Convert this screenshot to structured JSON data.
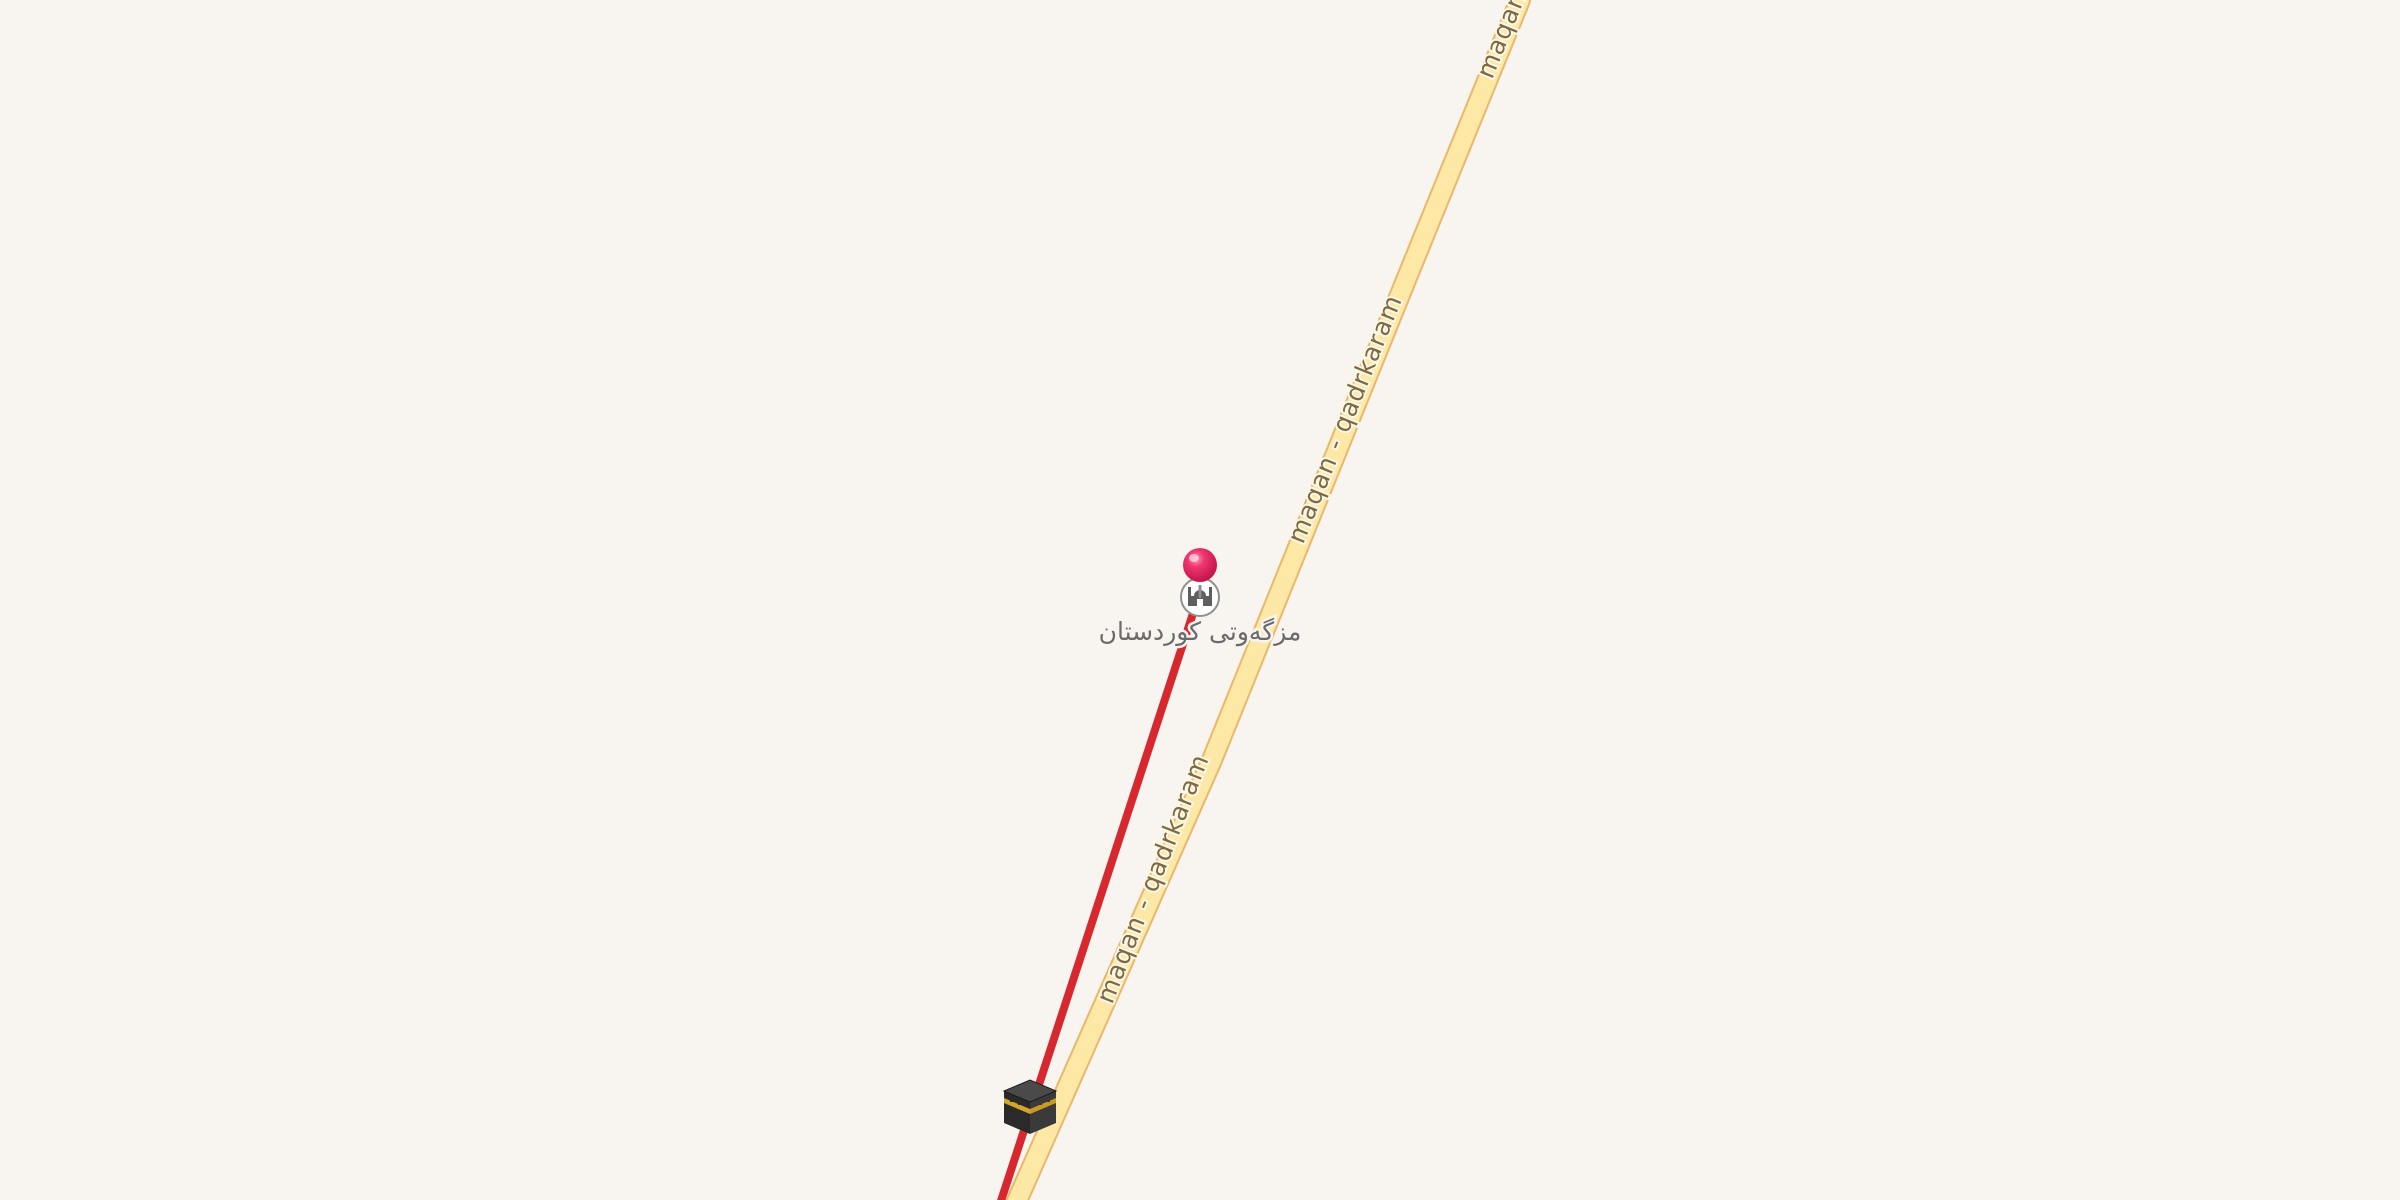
{
  "map": {
    "background_color": "#f8f4f0",
    "road": {
      "name": "maqan - qadrkaram",
      "fill_color": "#fde8a6",
      "casing_color": "#e9b86a"
    },
    "route": {
      "color": "#d7282f"
    },
    "poi": {
      "label": "مزگەوتی کوردستان",
      "icon": "mosque-icon"
    },
    "selected_pin": {
      "color": "#e91e63",
      "icon": "location-pin-icon"
    },
    "destination": {
      "icon": "kaaba-icon",
      "colors": {
        "body": "#2e2e2e",
        "band": "#d4a52a"
      }
    }
  }
}
